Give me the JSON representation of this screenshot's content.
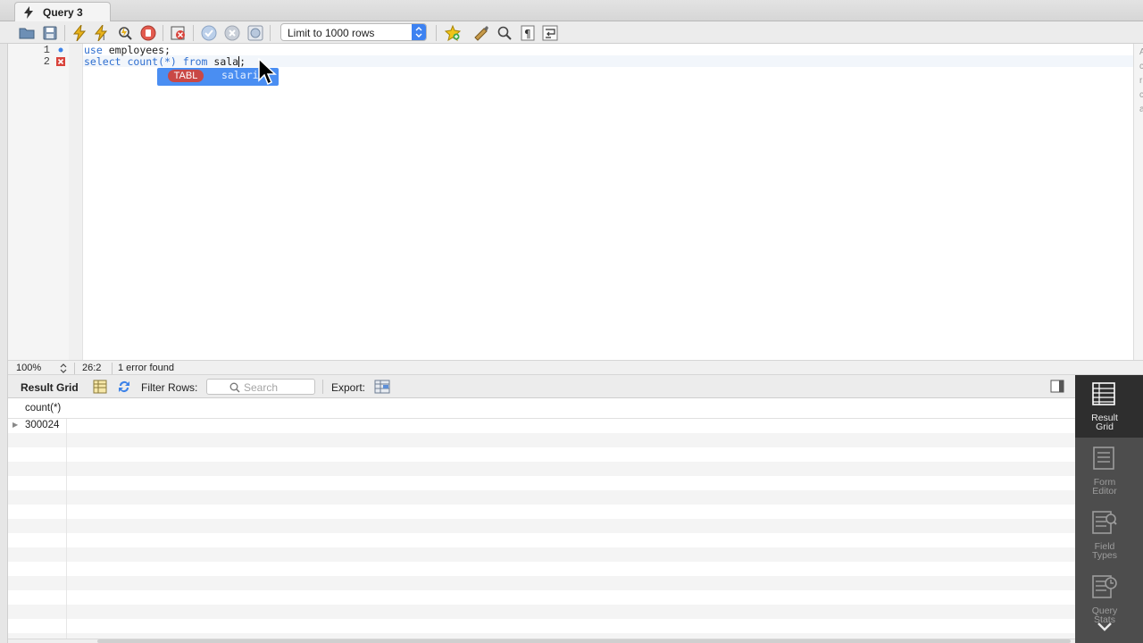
{
  "tab": {
    "title": "Query 3"
  },
  "toolbar": {
    "limit_select": "Limit to 1000 rows",
    "icons": [
      "folder-open-icon",
      "save-icon",
      "execute-icon",
      "execute-current-icon",
      "explain-icon",
      "stop-icon",
      "toggle-error-icon",
      "commit-icon",
      "rollback-icon",
      "autocommit-icon",
      "bookmark-icon",
      "beautify-icon",
      "find-icon",
      "invisible-chars-icon",
      "wrap-icon"
    ]
  },
  "editor": {
    "lines": [
      {
        "number": "1",
        "marker": "dot",
        "keyword": "use",
        "text": " employees;"
      },
      {
        "number": "2",
        "marker": "error",
        "keyword": "select count(*) from",
        "text": " sala",
        "after_cursor": ";"
      }
    ],
    "autocomplete": {
      "badge": "TABL",
      "suggestion": "salari"
    },
    "side_glyphs": [
      "A",
      "c",
      "r",
      "c",
      "a"
    ]
  },
  "status": {
    "zoom": "100%",
    "position": "26:2",
    "message": "1 error found"
  },
  "results": {
    "title": "Result Grid",
    "filter_label": "Filter Rows:",
    "search_placeholder": "Search",
    "export_label": "Export:",
    "columns": [
      "count(*)"
    ],
    "rows": [
      [
        "300024"
      ]
    ]
  },
  "side_panel": [
    {
      "label_1": "Result",
      "label_2": "Grid",
      "active": true
    },
    {
      "label_1": "Form",
      "label_2": "Editor",
      "active": false
    },
    {
      "label_1": "Field",
      "label_2": "Types",
      "active": false
    },
    {
      "label_1": "Query",
      "label_2": "Stats",
      "active": false
    }
  ]
}
